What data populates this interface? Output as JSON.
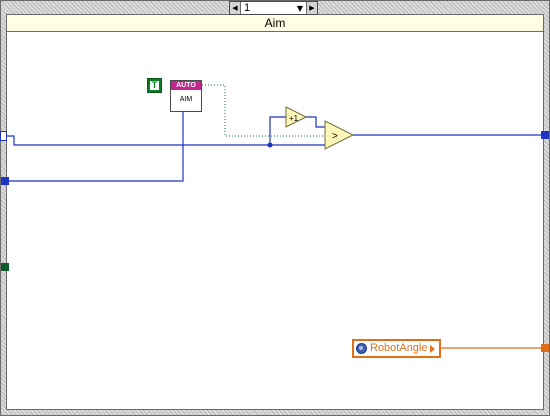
{
  "case_selector": {
    "value": "1",
    "decrement_icon": "triangle-left-icon",
    "increment_icon": "triangle-right-icon",
    "dropdown_icon": "triangle-down-icon"
  },
  "case_label": "Aim",
  "bool_constant": {
    "text": "T",
    "color": "#0f7a25"
  },
  "subvi": {
    "banner": "AUTO",
    "name": "AIM",
    "banner_color": "#c4268e"
  },
  "increment_node": {
    "text": "+1"
  },
  "compare_node": {
    "text": ">"
  },
  "global_variable": {
    "name": "RobotAngle",
    "icon": "globe-icon",
    "color": "#e07018"
  },
  "colors": {
    "numeric_wire": "#1d33c4",
    "boolean_wire": "#0f7a25",
    "double_wire": "#e07018",
    "structure_fill": "#ffffe4"
  }
}
